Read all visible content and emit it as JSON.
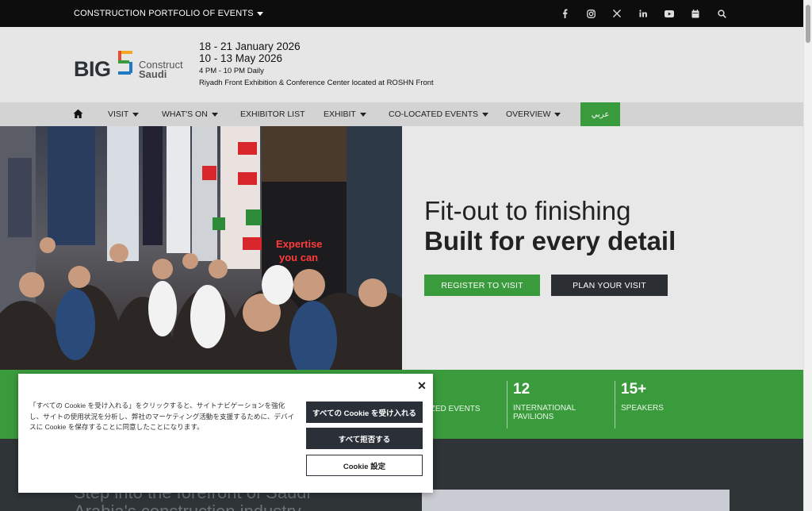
{
  "topbar": {
    "portfolio_label": "CONSTRUCTION PORTFOLIO OF EVENTS",
    "icons": [
      "facebook-icon",
      "instagram-icon",
      "x-icon",
      "linkedin-icon",
      "youtube-icon",
      "calendar-icon",
      "search-icon"
    ]
  },
  "header": {
    "logo": {
      "big": "BIG",
      "five": "5",
      "construct": "Construct",
      "saudi": "Saudi"
    },
    "date1": "18 - 21 January 2026",
    "date2": "10 - 13 May 2026",
    "hours": "4 PM - 10 PM Daily",
    "venue": "Riyadh Front Exhibition & Conference Center located at ROSHN Front"
  },
  "nav": {
    "items": [
      {
        "label": "VISIT",
        "dropdown": true
      },
      {
        "label": "WHAT'S ON",
        "dropdown": true
      },
      {
        "label": "EXHIBITOR LIST",
        "dropdown": false
      },
      {
        "label": "EXHIBIT",
        "dropdown": true
      },
      {
        "label": "CO-LOCATED EVENTS",
        "dropdown": true
      },
      {
        "label": "OVERVIEW",
        "dropdown": true
      }
    ],
    "arabic_label": "عربي"
  },
  "hero": {
    "image_text": "Expertise you can rely on",
    "line1": "Fit-out to finishing",
    "line2": "Built for every detail",
    "register_label": "REGISTER TO VISIT",
    "plan_label": "PLAN YOUR VISIT"
  },
  "stats": [
    {
      "num": "",
      "label": "IZED EVENTS"
    },
    {
      "num": "12",
      "label": "INTERNATIONAL PAVILIONS"
    },
    {
      "num": "15+",
      "label": "SPEAKERS"
    }
  ],
  "section": {
    "heading": "Step into the forefront of Saudi Arabia's construction industry"
  },
  "cookie": {
    "text": "「すべての Cookie を受け入れる」をクリックすると、サイトナビゲーションを強化し、サイトの使用状況を分析し、弊社のマーケティング活動を支援するために、デバイスに Cookie を保存することに同意したことになります。",
    "accept_label": "すべての Cookie を受け入れる",
    "reject_label": "すべて拒否する",
    "settings_label": "Cookie 設定"
  },
  "colors": {
    "brand_green": "#3a9b3c",
    "dark": "#2b2f33",
    "topbar": "#0d0d0d"
  }
}
